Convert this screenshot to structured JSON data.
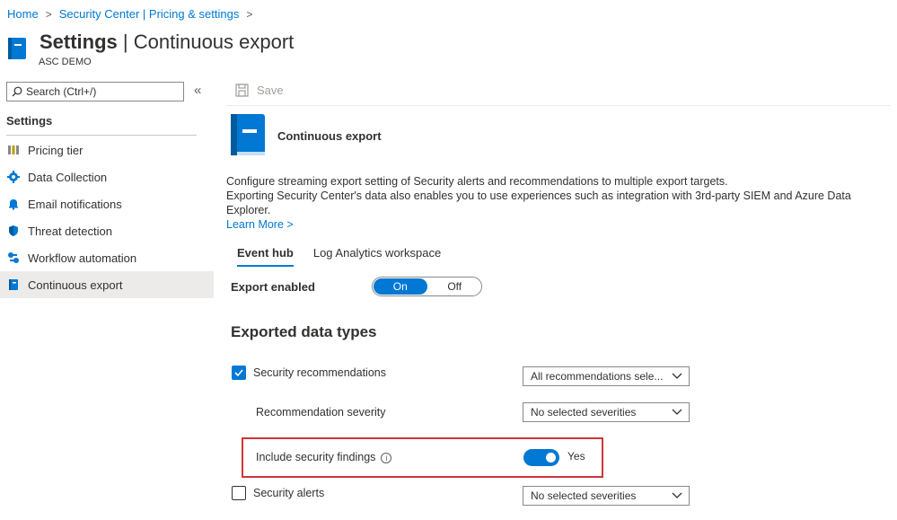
{
  "breadcrumb": {
    "items": [
      "Home",
      "Security Center | Pricing & settings"
    ]
  },
  "page": {
    "title_bold": "Settings",
    "title_rest": " | Continuous export",
    "subtitle": "ASC DEMO"
  },
  "sidebar": {
    "search_placeholder": "Search (Ctrl+/)",
    "collapse_icon": "double-chevron-left",
    "header": "Settings",
    "items": [
      {
        "label": "Pricing tier",
        "icon": "pricing-icon"
      },
      {
        "label": "Data Collection",
        "icon": "gear-icon"
      },
      {
        "label": "Email notifications",
        "icon": "bell-icon"
      },
      {
        "label": "Threat detection",
        "icon": "shield-icon"
      },
      {
        "label": "Workflow automation",
        "icon": "workflow-icon"
      },
      {
        "label": "Continuous export",
        "icon": "book-icon",
        "active": true
      }
    ]
  },
  "toolbar": {
    "save_label": "Save"
  },
  "section": {
    "title": "Continuous export",
    "description_line1": "Configure streaming export setting of Security alerts and recommendations to multiple export targets.",
    "description_line2": "Exporting Security Center's data also enables you to use experiences such as integration with 3rd-party SIEM and Azure Data Explorer.",
    "learn_more": "Learn More >"
  },
  "tabs": [
    {
      "label": "Event hub",
      "active": true
    },
    {
      "label": "Log Analytics workspace",
      "active": false
    }
  ],
  "export_enabled": {
    "label": "Export enabled",
    "on_label": "On",
    "off_label": "Off",
    "value": "On"
  },
  "data_types": {
    "heading": "Exported data types",
    "security_recommendations": {
      "label": "Security recommendations",
      "checked": true,
      "dropdown_value": "All recommendations sele..."
    },
    "recommendation_severity": {
      "label": "Recommendation severity",
      "dropdown_value": "No selected severities"
    },
    "include_findings": {
      "label": "Include security findings",
      "toggle_value": "Yes",
      "on": true
    },
    "security_alerts": {
      "label": "Security alerts",
      "checked": false,
      "dropdown_value": "No selected severities"
    }
  },
  "colors": {
    "accent": "#0078d4",
    "highlight_border": "#d13438"
  }
}
